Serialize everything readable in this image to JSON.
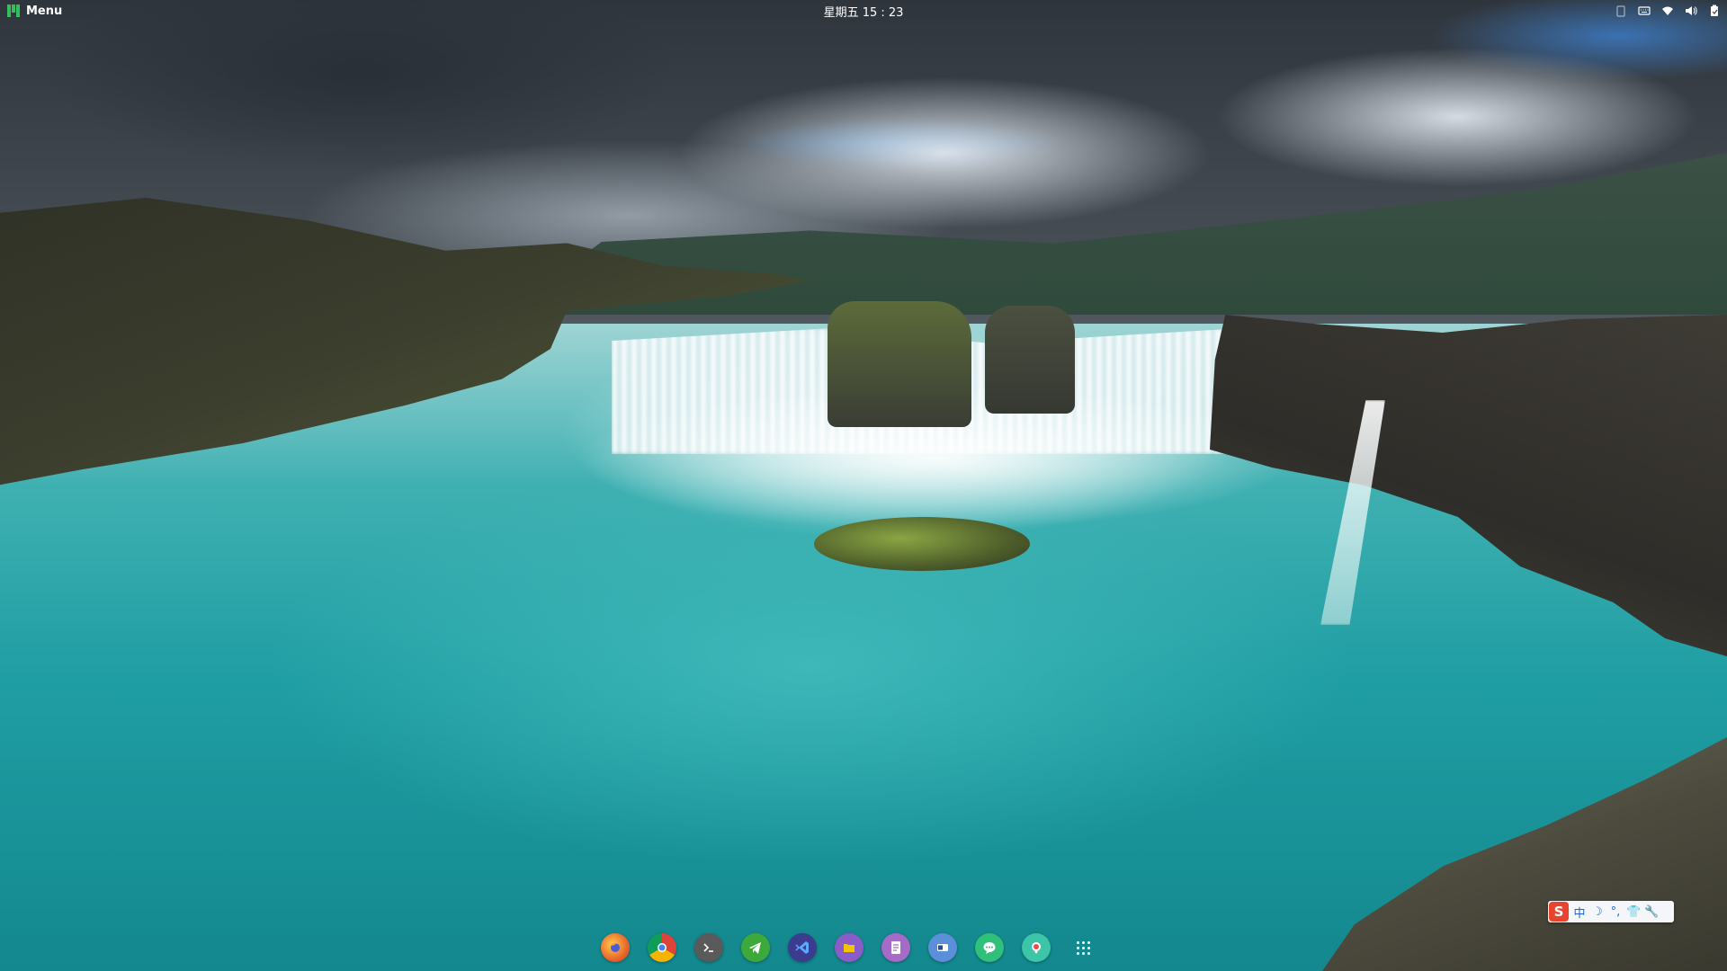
{
  "panel": {
    "menu_label": "Menu",
    "clock": "星期五 15 : 23",
    "tray_icons": [
      "clipboard-icon",
      "keyboard-icon",
      "wifi-icon",
      "volume-icon",
      "battery-icon"
    ]
  },
  "ime": {
    "logo": "S",
    "mode": "中",
    "items": [
      "moon-icon",
      "punctuation-icon",
      "shirt-icon",
      "wrench-icon"
    ]
  },
  "dock": {
    "apps": [
      {
        "name": "firefox",
        "color": "#e8672a"
      },
      {
        "name": "chrome",
        "color": "#4285f4"
      },
      {
        "name": "terminal",
        "color": "#5a5a5a"
      },
      {
        "name": "telegram",
        "color": "#3ea93b"
      },
      {
        "name": "vscode",
        "color": "#3b3b8f"
      },
      {
        "name": "files",
        "color": "#8a5cc9"
      },
      {
        "name": "text-editor",
        "color": "#a66bc9"
      },
      {
        "name": "window-switcher",
        "color": "#5b8fd9"
      },
      {
        "name": "chat",
        "color": "#2fc07a"
      },
      {
        "name": "screen-recorder",
        "color": "#3cc5a6"
      }
    ]
  }
}
